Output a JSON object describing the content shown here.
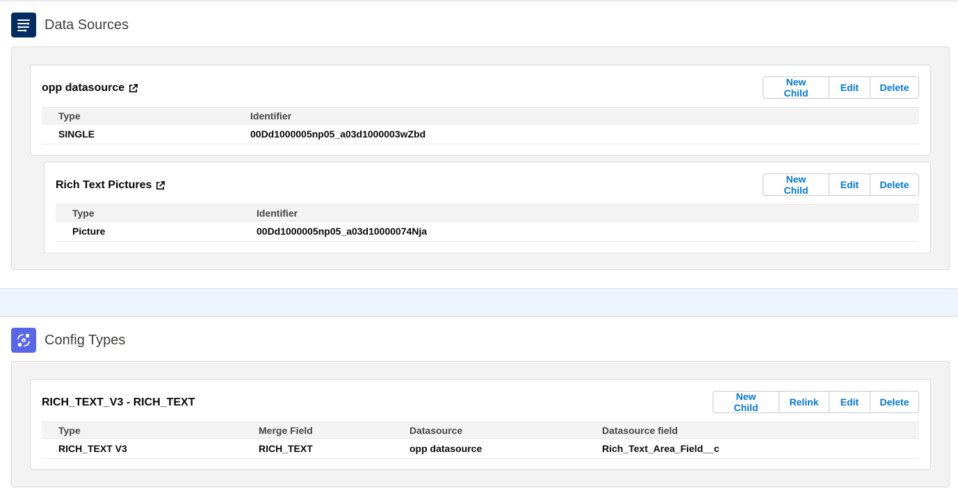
{
  "data_sources": {
    "title": "Data Sources",
    "icon": "flow-icon",
    "cards": [
      {
        "title": "opp datasource",
        "buttons": [
          "New Child",
          "Edit",
          "Delete"
        ],
        "columns": [
          "Type",
          "Identifier"
        ],
        "row": [
          "SINGLE",
          "00Dd1000005np05_a03d1000003wZbd"
        ]
      },
      {
        "title": "Rich Text Pictures",
        "buttons": [
          "New Child",
          "Edit",
          "Delete"
        ],
        "columns": [
          "Type",
          "Identifier"
        ],
        "row": [
          "Picture",
          "00Dd1000005np05_a03d10000074Nja"
        ]
      }
    ]
  },
  "config_types": {
    "title": "Config Types",
    "icon": "config-exchange-icon",
    "cards": [
      {
        "title": "RICH_TEXT_V3 - RICH_TEXT",
        "buttons": [
          "New Child",
          "Relink",
          "Edit",
          "Delete"
        ],
        "columns": [
          "Type",
          "Merge Field",
          "Datasource",
          "Datasource field"
        ],
        "row": [
          "RICH_TEXT V3",
          "RICH_TEXT",
          "opp datasource",
          "Rich_Text_Area_Field__c"
        ]
      }
    ]
  },
  "colors": {
    "brand_blue": "#0176d3",
    "ds_icon_bg": "#032d60",
    "ct_icon_bg": "#5867e8",
    "page_bg": "#eef4ff"
  }
}
